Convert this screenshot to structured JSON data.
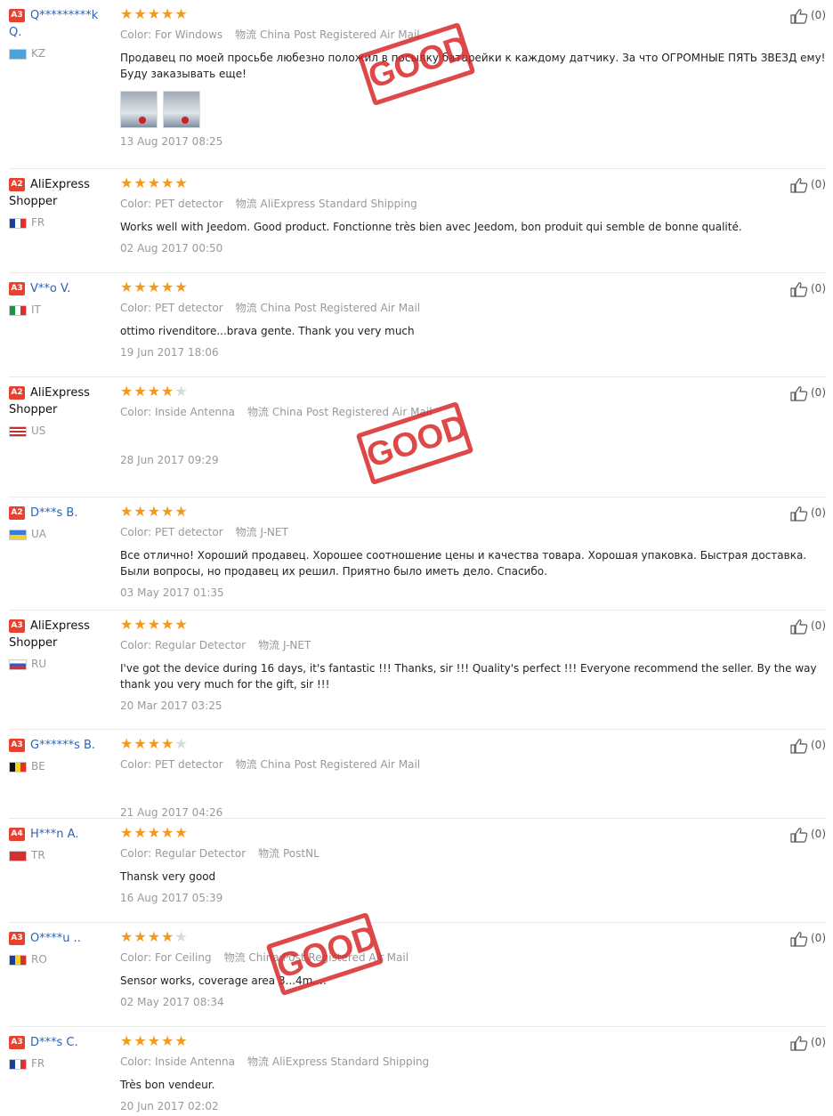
{
  "labels": {
    "color": "Color:",
    "shipping": "物流"
  },
  "stamp_text": "GOOD",
  "colors": {
    "badge": "#e8412e",
    "star": "#f39a1e",
    "username": "#2c64b4",
    "stamp": "#d72020"
  },
  "reviews": [
    {
      "level": "A3",
      "name": "Q*********k Q.",
      "shopper": false,
      "country": "KZ",
      "rating": 5,
      "color": "For Windows",
      "shipping": "China Post Registered Air Mail",
      "text": "Продавец по моей просьбе любезно положил в посылку батарейки к каждому датчику. За что ОГРОМНЫЕ ПЯТЬ ЗВЕЗД ему! Буду заказывать еще!",
      "date": "13 Aug 2017 08:25",
      "likes": "(0)",
      "images": 2
    },
    {
      "level": "A2",
      "name": "AliExpress Shopper",
      "shopper": true,
      "country": "FR",
      "rating": 5,
      "color": "PET detector",
      "shipping": "AliExpress Standard Shipping",
      "text": "Works well with Jeedom. Good product. Fonctionne très bien avec Jeedom, bon produit qui semble de bonne qualité.",
      "date": "02 Aug 2017 00:50",
      "likes": "(0)",
      "images": 0
    },
    {
      "level": "A3",
      "name": "V**o V.",
      "shopper": false,
      "country": "IT",
      "rating": 5,
      "color": "PET detector",
      "shipping": "China Post Registered Air Mail",
      "text": "ottimo rivenditore...brava gente. Thank you very much",
      "date": "19 Jun 2017 18:06",
      "likes": "(0)",
      "images": 0
    },
    {
      "level": "A2",
      "name": "AliExpress Shopper",
      "shopper": true,
      "country": "US",
      "rating": 4,
      "color": "Inside Antenna",
      "shipping": "China Post Registered Air Mail",
      "text": "",
      "date": "28 Jun 2017 09:29",
      "likes": "(0)",
      "images": 0
    },
    {
      "level": "A2",
      "name": "D***s B.",
      "shopper": false,
      "country": "UA",
      "rating": 5,
      "color": "PET detector",
      "shipping": "J-NET",
      "text": "Все отлично! Хороший продавец. Хорошее соотношение цены и качества товара. Хорошая упаковка. Быстрая доставка. Были вопросы, но продавец их решил. Приятно было иметь дело. Спасибо.",
      "date": "03 May 2017 01:35",
      "likes": "(0)",
      "images": 0
    },
    {
      "level": "A3",
      "name": "AliExpress Shopper",
      "shopper": true,
      "country": "RU",
      "rating": 5,
      "color": "Regular Detector",
      "shipping": "J-NET",
      "text": "I've got the device during 16 days, it's fantastic !!! Thanks, sir !!! Quality's perfect !!! Everyone recommend the seller. By the way thank you very much for the gift, sir !!!",
      "date": "20 Mar 2017 03:25",
      "likes": "(0)",
      "images": 0
    },
    {
      "level": "A3",
      "name": "G******s B.",
      "shopper": false,
      "country": "BE",
      "rating": 4,
      "color": "PET detector",
      "shipping": "China Post Registered Air Mail",
      "text": "",
      "date": "21 Aug 2017 04:26",
      "likes": "(0)",
      "images": 0
    },
    {
      "level": "A4",
      "name": "H***n A.",
      "shopper": false,
      "country": "TR",
      "rating": 5,
      "color": "Regular Detector",
      "shipping": "PostNL",
      "text": "Thansk very good",
      "date": "16 Aug 2017 05:39",
      "likes": "(0)",
      "images": 0
    },
    {
      "level": "A3",
      "name": "O****u ..",
      "shopper": false,
      "country": "RO",
      "rating": 4,
      "color": "For Ceiling",
      "shipping": "China Post Registered Air Mail",
      "text": "Sensor works, coverage area 3...4m....",
      "date": "02 May 2017 08:34",
      "likes": "(0)",
      "images": 0
    },
    {
      "level": "A3",
      "name": "D***s C.",
      "shopper": false,
      "country": "FR",
      "rating": 5,
      "color": "Inside Antenna",
      "shipping": "AliExpress Standard Shipping",
      "text": "Très bon vendeur.",
      "date": "20 Jun 2017 02:02",
      "likes": "(0)",
      "images": 0
    }
  ]
}
